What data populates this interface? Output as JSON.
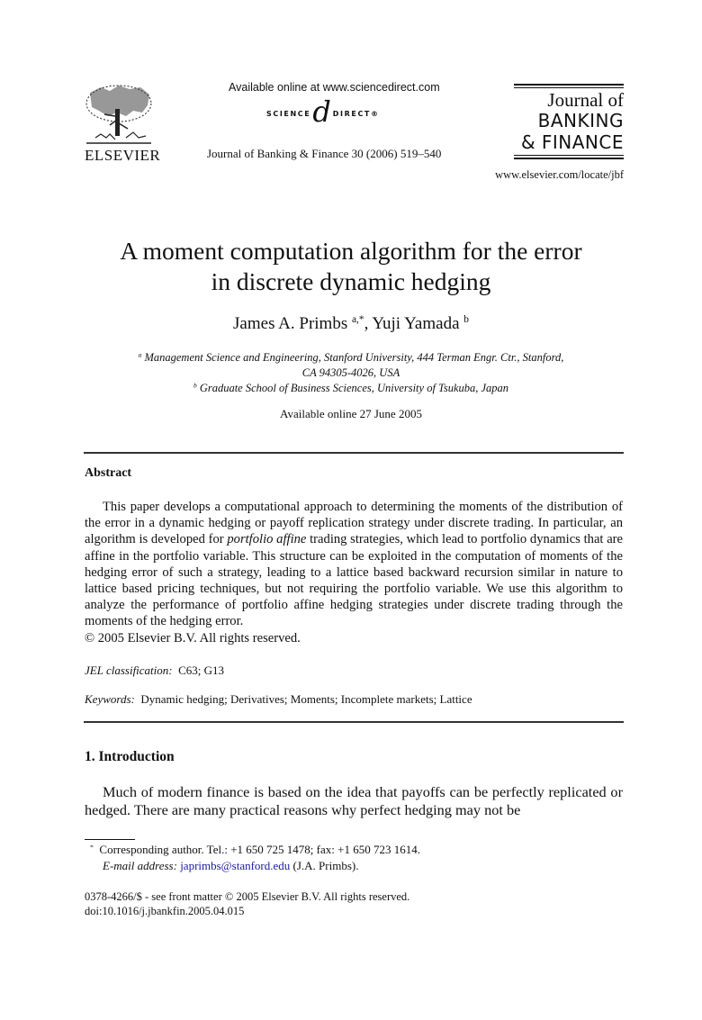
{
  "header": {
    "publisher_logo_text": "ELSEVIER",
    "sciencedirect_available": "Available online at www.sciencedirect.com",
    "sciencedirect_logo": {
      "left": "SCIENCE",
      "glyph": "d",
      "right": "DIRECT",
      "mark": "®"
    },
    "journal_citation": "Journal of Banking & Finance 30 (2006) 519–540",
    "journal_logo": {
      "line1": "Journal of",
      "line2": "BANKING",
      "line3": "& FINANCE"
    },
    "journal_url": "www.elsevier.com/locate/jbf"
  },
  "article": {
    "title_line1": "A moment computation algorithm for the error",
    "title_line2": "in discrete dynamic hedging",
    "authors": [
      {
        "name": "James A. Primbs",
        "sup": "a,*"
      },
      {
        "name": "Yuji Yamada",
        "sup": "b"
      }
    ],
    "author_separator": ", ",
    "affiliations": [
      {
        "mark": "a",
        "line1": "Management Science and Engineering, Stanford University, 444 Terman Engr. Ctr., Stanford,",
        "line2": "CA 94305-4026, USA"
      },
      {
        "mark": "b",
        "line1": "Graduate School of Business Sciences, University of Tsukuba, Japan"
      }
    ],
    "available_online": "Available online 27 June 2005"
  },
  "abstract": {
    "heading": "Abstract",
    "text_before_italic": "This paper develops a computational approach to determining the moments of the distribution of the error in a dynamic hedging or payoff replication strategy under discrete trading. In particular, an algorithm is developed for ",
    "italic_term": "portfolio affine",
    "text_after_italic": " trading strategies, which lead to portfolio dynamics that are affine in the portfolio variable. This structure can be exploited in the computation of moments of the hedging error of such a strategy, leading to a lattice based backward recursion similar in nature to lattice based pricing techniques, but not requiring the portfolio variable. We use this algorithm to analyze the performance of portfolio affine hedging strategies under discrete trading through the moments of the hedging error.",
    "copyright": "© 2005 Elsevier B.V. All rights reserved."
  },
  "jel": {
    "label": "JEL classification:",
    "value": "C63; G13"
  },
  "keywords": {
    "label": "Keywords:",
    "value": "Dynamic hedging; Derivatives; Moments; Incomplete markets; Lattice"
  },
  "introduction": {
    "heading": "1. Introduction",
    "text": "Much of modern finance is based on the idea that payoffs can be perfectly replicated or hedged. There are many practical reasons why perfect hedging may not be"
  },
  "footnotes": {
    "corresponding_mark": "*",
    "corresponding_text": "Corresponding author. Tel.: +1 650 725 1478; fax: +1 650 723 1614.",
    "email_label": "E-mail address:",
    "email": "japrimbs@stanford.edu",
    "email_owner": " (J.A. Primbs)."
  },
  "front_matter": {
    "issn_line": "0378-4266/$ - see front matter © 2005 Elsevier B.V. All rights reserved.",
    "doi": "doi:10.1016/j.jbankfin.2005.04.015"
  },
  "colors": {
    "link": "#1a1a9e",
    "text": "#111111"
  }
}
